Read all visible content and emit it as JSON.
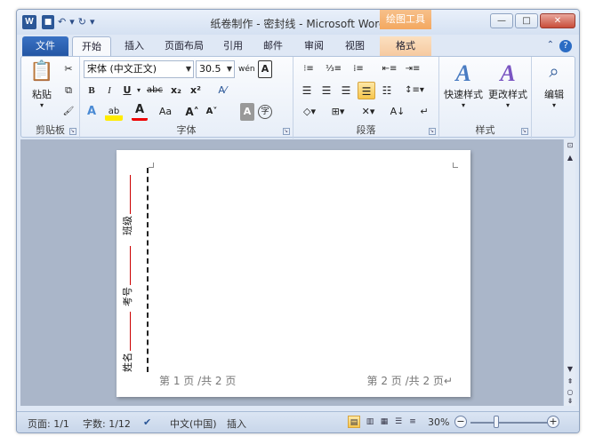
{
  "window": {
    "title": "纸卷制作 - 密封线 - Microsoft Word",
    "contextual_tab_title": "绘图工具",
    "word_logo": "W",
    "qat": {
      "save": "■",
      "undo": "↶",
      "redo": "↻",
      "customize": "▾"
    },
    "controls": {
      "minimize": "—",
      "maximize": "□",
      "close": "✕"
    }
  },
  "tabs": [
    "文件",
    "开始",
    "插入",
    "页面布局",
    "引用",
    "邮件",
    "审阅",
    "视图",
    "格式"
  ],
  "help_icons": {
    "collapse": "⌃",
    "help": "?"
  },
  "ribbon": {
    "clipboard": {
      "label": "剪贴板",
      "paste": "粘贴",
      "cut": "✂",
      "copy": "⧉",
      "format_painter": "🖌"
    },
    "font": {
      "label": "字体",
      "font_name": "宋体 (中文正文)",
      "font_size": "30.5",
      "grow": "A˄",
      "shrink": "A˅",
      "phonetic": "wén",
      "border_char": "A",
      "bold": "B",
      "italic": "I",
      "underline": "U",
      "strike": "abc",
      "subscript": "x₂",
      "superscript": "x²",
      "clear": "A⁄",
      "effects": "A",
      "highlight": "ab",
      "font_color": "A",
      "change_case": "Aa",
      "char_shading": "A",
      "enclose": "字"
    },
    "paragraph": {
      "label": "段落"
    },
    "styles": {
      "label": "样式",
      "quick_styles": "快速样式",
      "change_styles": "更改样式"
    },
    "editing": {
      "label": "编辑",
      "find": "编辑"
    }
  },
  "document": {
    "labels": [
      "班级",
      "考号",
      "姓名"
    ],
    "footer_left": "第 1 页 /共 2 页",
    "footer_right": "第 2 页 /共 2 页↵"
  },
  "statusbar": {
    "page": "页面: 1/1",
    "words": "字数: 1/12",
    "language": "中文(中国)",
    "mode": "插入",
    "zoom": "30%",
    "zoom_level": 0.3
  }
}
